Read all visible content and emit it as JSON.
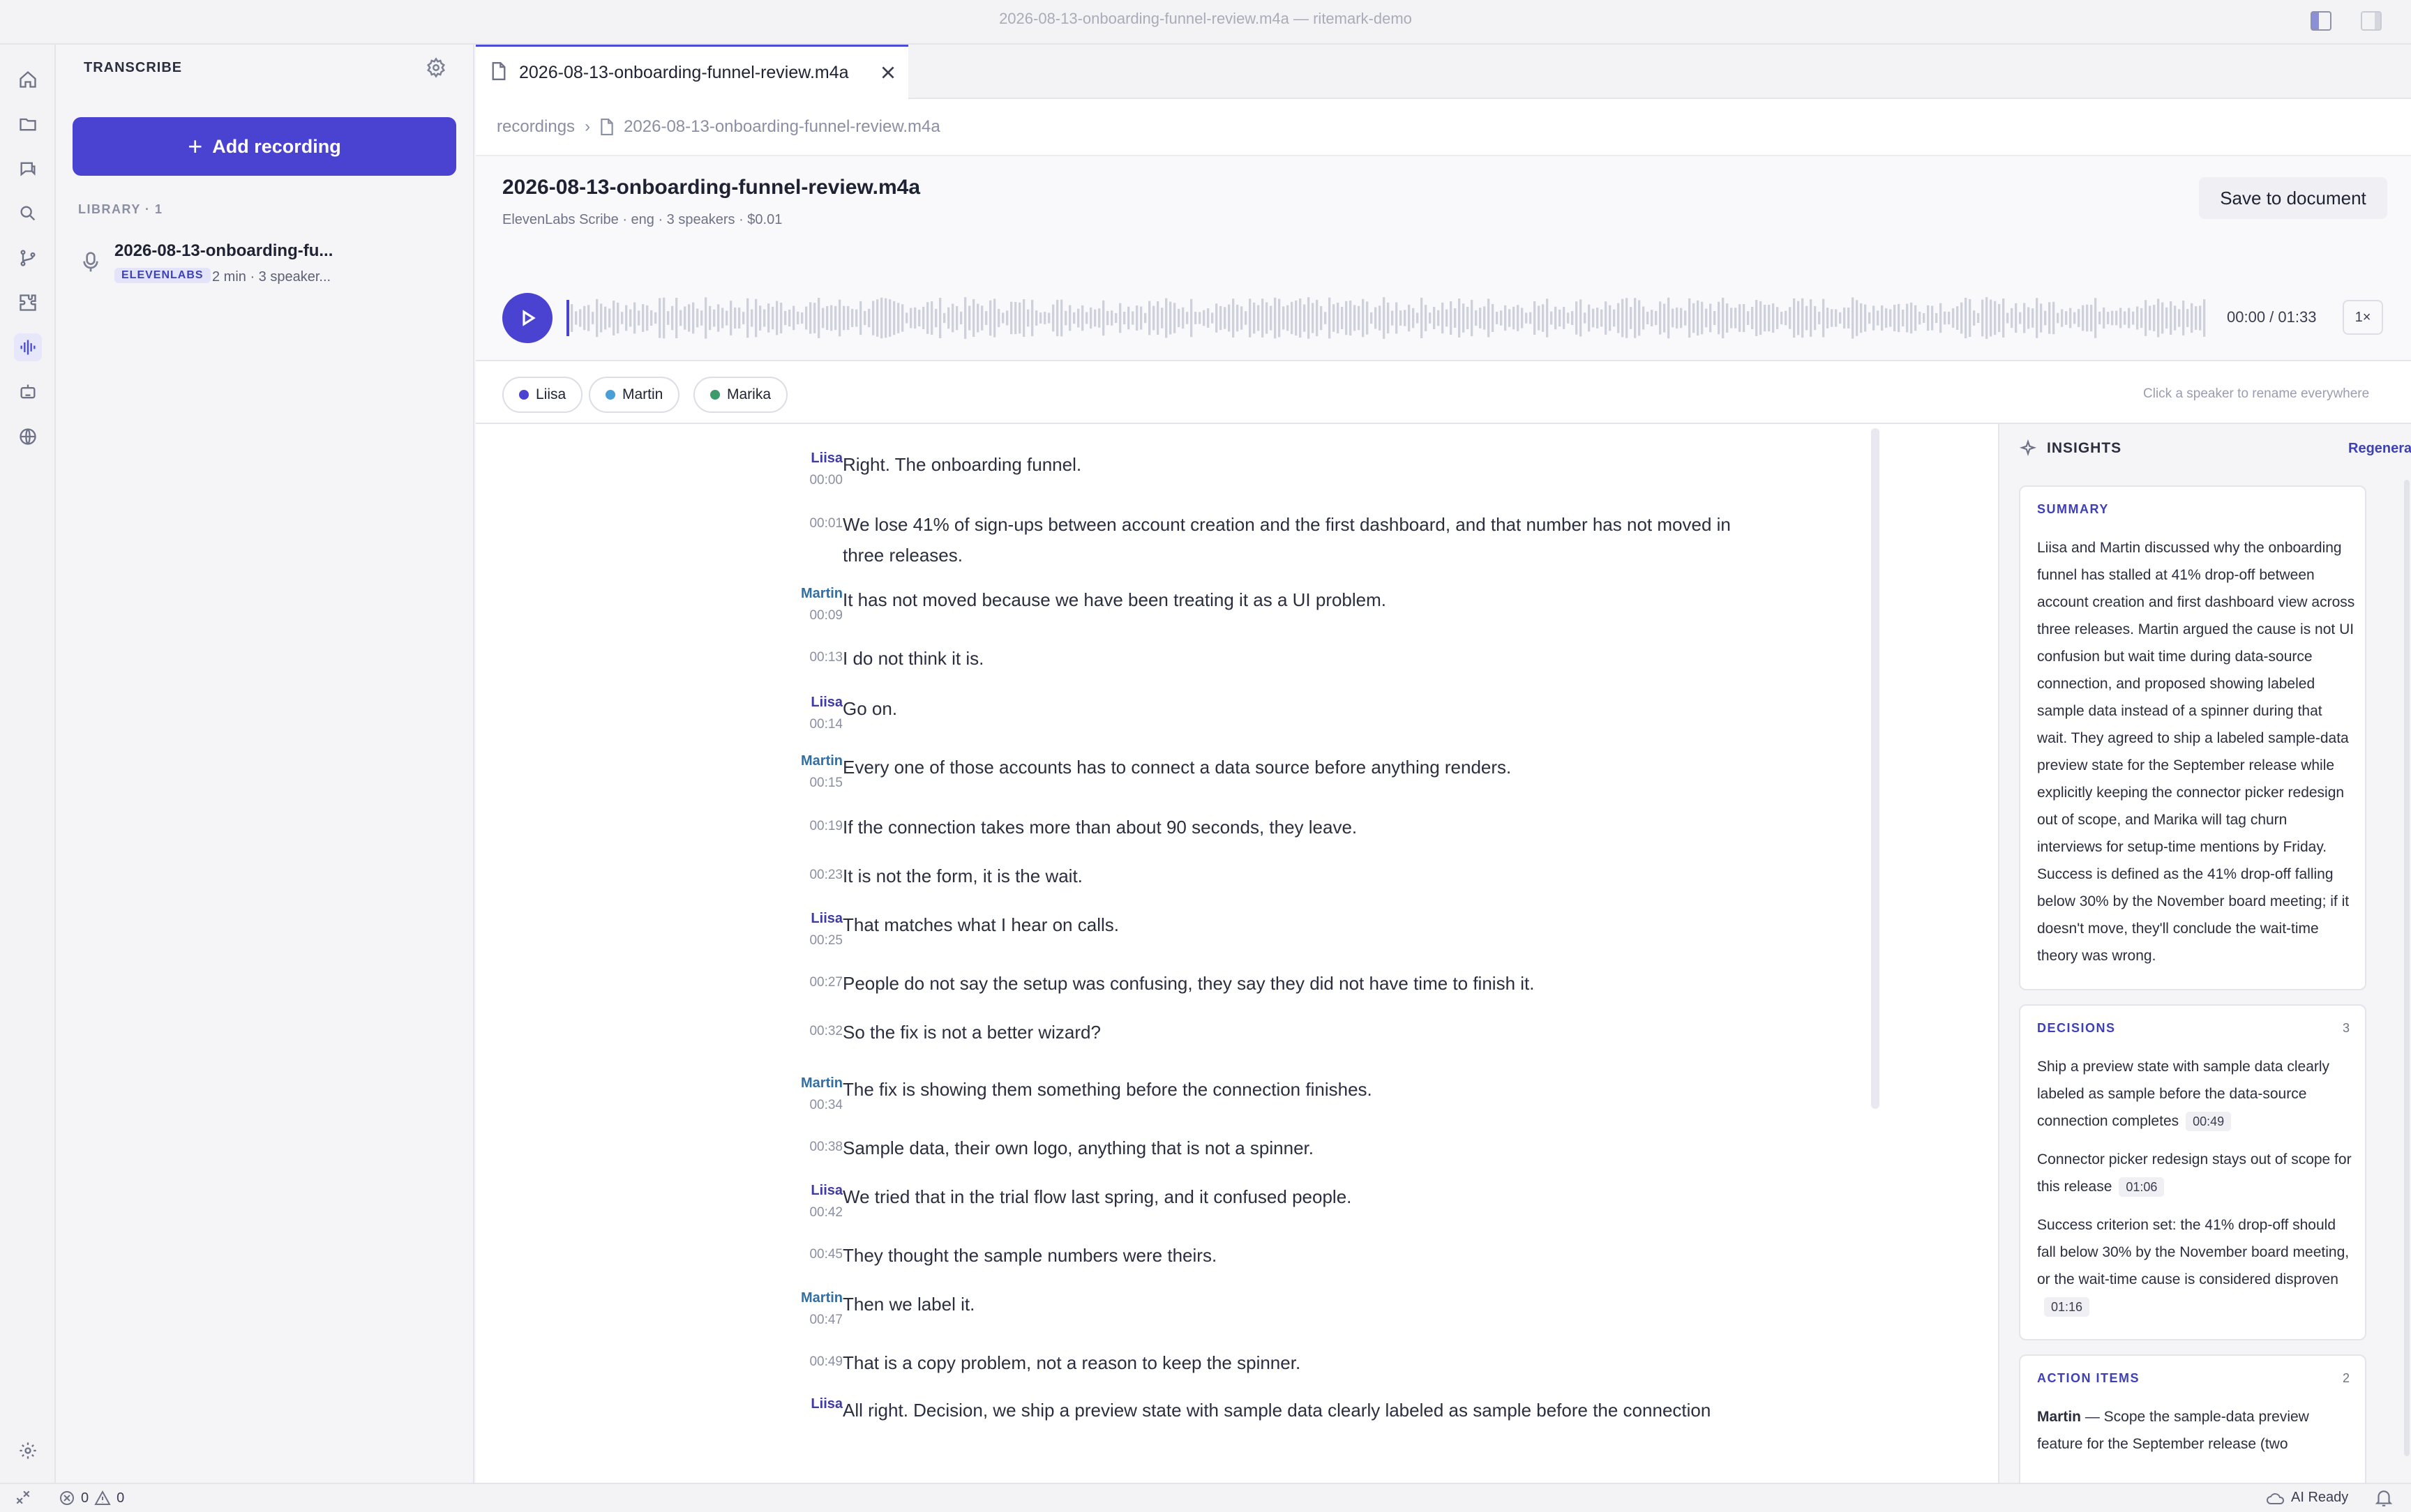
{
  "window": {
    "title": "2026-08-13-onboarding-funnel-review.m4a — ritemark-demo"
  },
  "activity_bar": {
    "icons": [
      "home-icon",
      "folder-icon",
      "chat-icon",
      "search-icon",
      "git-branch-icon",
      "extensions-icon",
      "transcribe-icon",
      "robot-icon",
      "globe-icon",
      "settings-icon"
    ]
  },
  "sidebar": {
    "title": "TRANSCRIBE",
    "add_label": "Add recording",
    "library_label": "LIBRARY",
    "library_count": "· 1",
    "items": [
      {
        "name": "2026-08-13-onboarding-fu...",
        "badge": "ELEVENLABS",
        "meta": "2 min · 3 speaker..."
      }
    ]
  },
  "tab": {
    "title": "2026-08-13-onboarding-funnel-review.m4a"
  },
  "breadcrumb": {
    "root": "recordings",
    "file": "2026-08-13-onboarding-funnel-review.m4a"
  },
  "recording": {
    "title": "2026-08-13-onboarding-funnel-review.m4a",
    "meta": "ElevenLabs Scribe · eng · 3 speakers · $0.01",
    "save_label": "Save to document",
    "time": "00:00 / 01:33",
    "speed": "1×",
    "progress": 0
  },
  "speakers": {
    "hint": "Click a speaker to rename everywhere",
    "list": [
      {
        "name": "Liisa",
        "color": "#4a42d0"
      },
      {
        "name": "Martin",
        "color": "#4a9fd8"
      },
      {
        "name": "Marika",
        "color": "#3e9a6a"
      }
    ]
  },
  "transcript": [
    {
      "speaker": "Liisa",
      "time": "00:00",
      "text": "Right. The onboarding funnel."
    },
    {
      "speaker": "",
      "time": "00:01",
      "text": "We lose 41% of sign-ups between account creation and the first dashboard, and that number has not moved in three releases."
    },
    {
      "speaker": "Martin",
      "time": "00:09",
      "text": "It has not moved because we have been treating it as a UI problem."
    },
    {
      "speaker": "",
      "time": "00:13",
      "text": "I do not think it is."
    },
    {
      "speaker": "Liisa",
      "time": "00:14",
      "text": "Go on."
    },
    {
      "speaker": "Martin",
      "time": "00:15",
      "text": "Every one of those accounts has to connect a data source before anything renders."
    },
    {
      "speaker": "",
      "time": "00:19",
      "text": "If the connection takes more than about 90 seconds, they leave."
    },
    {
      "speaker": "",
      "time": "00:23",
      "text": "It is not the form, it is the wait."
    },
    {
      "speaker": "Liisa",
      "time": "00:25",
      "text": "That matches what I hear on calls."
    },
    {
      "speaker": "",
      "time": "00:27",
      "text": "People do not say the setup was confusing, they say they did not have time to finish it."
    },
    {
      "speaker": "",
      "time": "00:32",
      "text": "So the fix is not a better wizard?"
    },
    {
      "speaker": "Martin",
      "time": "00:34",
      "text": "The fix is showing them something before the connection finishes."
    },
    {
      "speaker": "",
      "time": "00:38",
      "text": "Sample data, their own logo, anything that is not a spinner."
    },
    {
      "speaker": "Liisa",
      "time": "00:42",
      "text": "We tried that in the trial flow last spring, and it confused people."
    },
    {
      "speaker": "",
      "time": "00:45",
      "text": "They thought the sample numbers were theirs."
    },
    {
      "speaker": "Martin",
      "time": "00:47",
      "text": "Then we label it."
    },
    {
      "speaker": "",
      "time": "00:49",
      "text": "That is a copy problem, not a reason to keep the spinner."
    },
    {
      "speaker": "Liisa",
      "time": "",
      "text": "All right. Decision, we ship a preview state with sample data clearly labeled as sample before the connection"
    }
  ],
  "insights": {
    "title": "INSIGHTS",
    "regenerate_label": "Regenerate",
    "summary": {
      "heading": "SUMMARY",
      "text": "Liisa and Martin discussed why the onboarding funnel has stalled at 41% drop-off between account creation and first dashboard view across three releases. Martin argued the cause is not UI confusion but wait time during data-source connection, and proposed showing labeled sample data instead of a spinner during that wait. They agreed to ship a labeled sample-data preview state for the September release while explicitly keeping the connector picker redesign out of scope, and Marika will tag churn interviews for setup-time mentions by Friday. Success is defined as the 41% drop-off falling below 30% by the November board meeting; if it doesn't move, they'll conclude the wait-time theory was wrong."
    },
    "decisions": {
      "heading": "DECISIONS",
      "count": "3",
      "items": [
        {
          "text": "Ship a preview state with sample data clearly labeled as sample before the data-source connection completes",
          "time": "00:49"
        },
        {
          "text": "Connector picker redesign stays out of scope for this release",
          "time": "01:06"
        },
        {
          "text": "Success criterion set: the 41% drop-off should fall below 30% by the November board meeting, or the wait-time cause is considered disproven",
          "time": "01:16"
        }
      ]
    },
    "actions": {
      "heading": "ACTION ITEMS",
      "count": "2",
      "items": [
        {
          "owner": "Martin",
          "text": " — Scope the sample-data preview feature for the September release (two"
        }
      ]
    }
  },
  "statusbar": {
    "errors": "0",
    "warnings": "0",
    "ai_status": "AI Ready"
  }
}
